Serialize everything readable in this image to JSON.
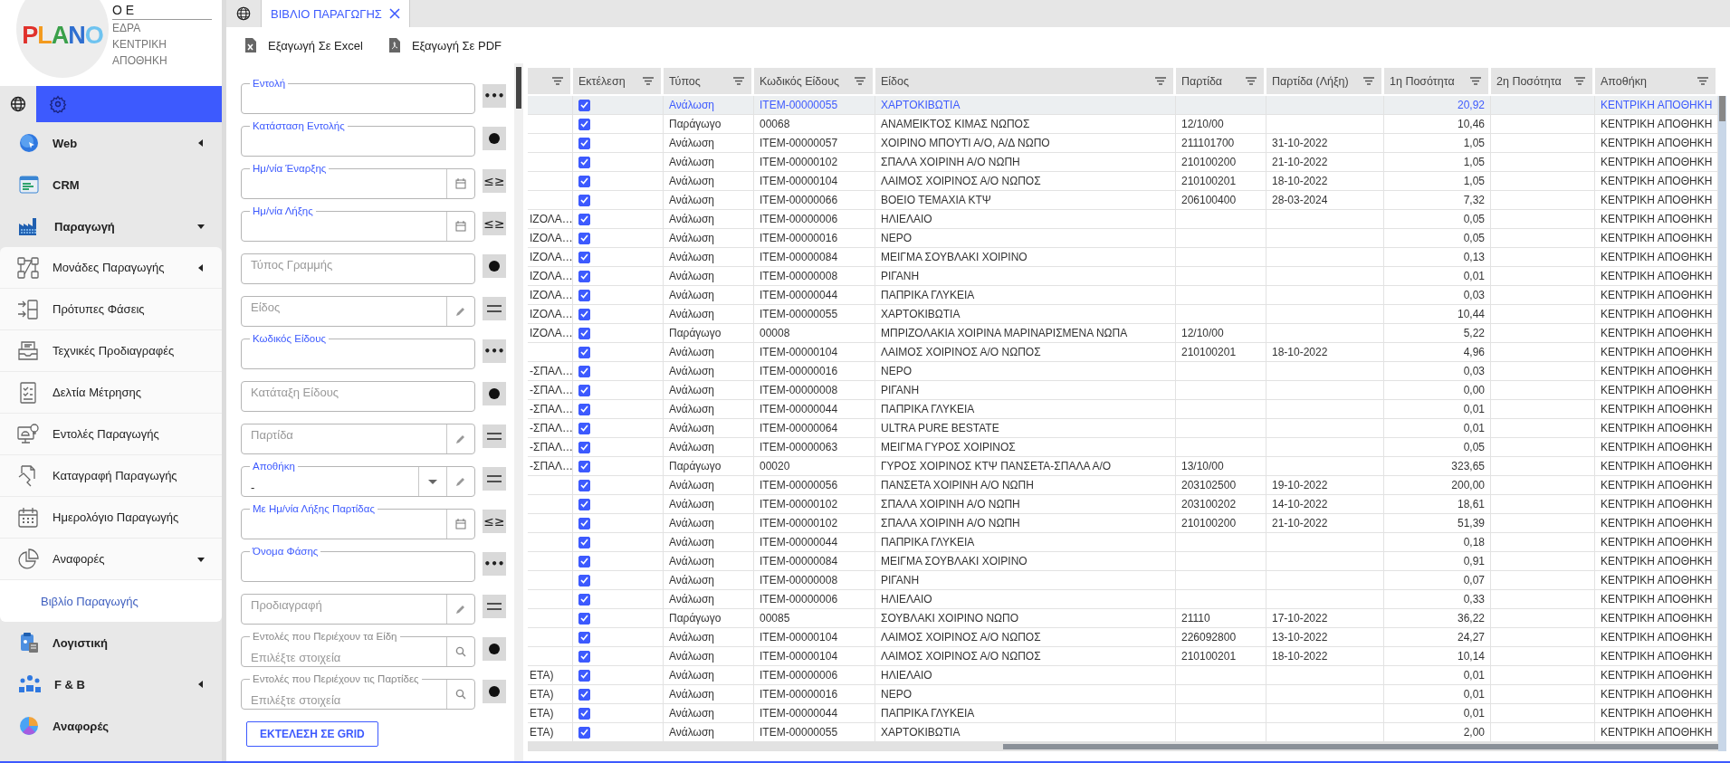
{
  "sidebar": {
    "logo": "PLANO",
    "company": "Ο Ε",
    "branch": "ΕΔΡΑ",
    "warehouse": "ΚΕΝΤΡΙΚΗ ΑΠΟΘΗΚΗ",
    "tabs": [
      {
        "selected": false
      },
      {
        "selected": true
      }
    ],
    "menu": [
      {
        "label": "Web",
        "expanded": false,
        "selected": false
      },
      {
        "label": "CRM",
        "selected": false
      },
      {
        "label": "Παραγωγή",
        "expanded": true,
        "selected": false,
        "children": [
          {
            "label": "Μονάδες Παραγωγής",
            "expanded": false,
            "selected": false
          },
          {
            "label": "Πρότυπες Φάσεις",
            "selected": false
          },
          {
            "label": "Τεχνικές Προδιαγραφές",
            "selected": false
          },
          {
            "label": "Δελτία Μέτρησης",
            "selected": false
          },
          {
            "label": "Εντολές Παραγωγής",
            "selected": false
          },
          {
            "label": "Καταγραφή Παραγωγής",
            "selected": false
          },
          {
            "label": "Ημερολόγιο Παραγωγής",
            "selected": false
          },
          {
            "label": "Αναφορές",
            "expanded": true,
            "selected": false,
            "children": [
              {
                "label": "Βιβλίο Παραγωγής",
                "selected": true
              }
            ]
          }
        ]
      },
      {
        "label": "Λογιστική",
        "selected": false
      },
      {
        "label": "F & B",
        "expanded": false,
        "selected": false
      },
      {
        "label": "Αναφορές",
        "selected": false
      }
    ]
  },
  "tabs": [
    {
      "kind": "home",
      "selected": false
    },
    {
      "kind": "document",
      "label": "ΒΙΒΛΙΟ ΠΑΡΑΓΩΓΗΣ",
      "selected": true,
      "closable": true
    }
  ],
  "toolbar": {
    "actions": [
      {
        "kind": "excel",
        "label": "Εξαγωγή Σε Excel"
      },
      {
        "kind": "pdf",
        "label": "Εξαγωγή Σε PDF"
      }
    ]
  },
  "filters": {
    "fields": [
      {
        "label": "Εντολή",
        "label_highlighted": true,
        "button": {
          "kind": "more",
          "text": "•••"
        }
      },
      {
        "label": "Κατάσταση Εντολής",
        "label_highlighted": true,
        "button": {
          "kind": "dot"
        }
      },
      {
        "label": "Ημ/νία Έναρξης",
        "label_highlighted": true,
        "adornments": [
          {
            "kind": "calendar"
          }
        ],
        "button": {
          "kind": "range",
          "text": "≤≥"
        }
      },
      {
        "label": "Ημ/νία Λήξης",
        "label_highlighted": true,
        "adornments": [
          {
            "kind": "calendar"
          }
        ],
        "button": {
          "kind": "range",
          "text": "≤≥"
        }
      },
      {
        "placeholder": "Τύπος Γραμμής",
        "button": {
          "kind": "dot"
        }
      },
      {
        "placeholder": "Είδος",
        "adornments": [
          {
            "kind": "pencil"
          }
        ],
        "button": {
          "kind": "equals"
        }
      },
      {
        "label": "Κωδικός Είδους",
        "label_highlighted": true,
        "button": {
          "kind": "more",
          "text": "•••"
        }
      },
      {
        "placeholder": "Κατάταξη Είδους",
        "button": {
          "kind": "dot"
        }
      },
      {
        "placeholder": "Παρτίδα",
        "adornments": [
          {
            "kind": "pencil"
          }
        ],
        "button": {
          "kind": "equals"
        }
      },
      {
        "label": "Αποθήκη",
        "label_highlighted": true,
        "value": "-",
        "adornments": [
          {
            "kind": "dropdown"
          },
          {
            "kind": "pencil"
          }
        ],
        "button": {
          "kind": "equals"
        }
      },
      {
        "label": "Με Ημ/νία Λήξης Παρτίδας",
        "label_highlighted": true,
        "adornments": [
          {
            "kind": "calendar"
          }
        ],
        "button": {
          "kind": "range",
          "text": "≤≥"
        }
      },
      {
        "label": "Όνομα Φάσης",
        "label_highlighted": true,
        "button": {
          "kind": "more",
          "text": "•••"
        }
      },
      {
        "placeholder": "Προδιαγραφή",
        "adornments": [
          {
            "kind": "pencil"
          }
        ],
        "button": {
          "kind": "equals"
        }
      },
      {
        "label": "Εντολές που Περιέχουν τα Είδη",
        "label_highlighted": false,
        "placeholder": "Επιλέξτε στοιχεία",
        "adornments": [
          {
            "kind": "search"
          }
        ],
        "button": {
          "kind": "dot"
        }
      },
      {
        "label": "Εντολές που Περιέχουν τις Παρτίδες",
        "label_highlighted": false,
        "placeholder": "Επιλέξτε στοιχεία",
        "adornments": [
          {
            "kind": "search"
          }
        ],
        "button": {
          "kind": "dot"
        }
      }
    ],
    "run_button": "ΕΚΤΕΛΕΣΗ ΣΕ GRID"
  },
  "table": {
    "columns": [
      {
        "kind": "text"
      },
      {
        "kind": "check",
        "label": "Εκτέλεση"
      },
      {
        "kind": "text",
        "label": "Τύπος"
      },
      {
        "kind": "text",
        "label": "Κωδικός Είδους"
      },
      {
        "kind": "text",
        "label": "Είδος"
      },
      {
        "kind": "text",
        "label": "Παρτίδα"
      },
      {
        "kind": "text",
        "label": "Παρτίδα (Λήξη)"
      },
      {
        "kind": "number",
        "label": "1η Ποσότητα"
      },
      {
        "kind": "number",
        "label": "2η Ποσότητα"
      },
      {
        "kind": "text",
        "label": "Αποθήκη"
      }
    ],
    "rows": [
      {
        "selected": true,
        "executed": true,
        "type": "Ανάλωση",
        "item_code": "ITEM-00000055",
        "item": "ΧΑΡΤΟΚΙΒΩΤΙΑ",
        "quantity_1": "20,92",
        "warehouse": "ΚΕΝΤΡΙΚΗ ΑΠΟΘΗΚΗ"
      },
      {
        "selected": false,
        "executed": true,
        "type": "Παράγωγο",
        "item_code": "00068",
        "item": "ΑΝΑΜΕΙΚΤΟΣ ΚΙΜΑΣ ΝΩΠΟΣ",
        "batch": "12/10/00",
        "quantity_1": "10,46",
        "warehouse": "ΚΕΝΤΡΙΚΗ ΑΠΟΘΗΚΗ"
      },
      {
        "selected": false,
        "executed": true,
        "type": "Ανάλωση",
        "item_code": "ITEM-00000057",
        "item": "ΧΟΙΡΙΝΟ ΜΠΟΥΤΙ Α/Ο, Α/Δ ΝΩΠΟ",
        "batch": "211101700",
        "batch_expiry": "31-10-2022",
        "quantity_1": "1,05",
        "warehouse": "ΚΕΝΤΡΙΚΗ ΑΠΟΘΗΚΗ"
      },
      {
        "selected": false,
        "executed": true,
        "type": "Ανάλωση",
        "item_code": "ITEM-00000102",
        "item": "ΣΠΑΛΑ ΧΟΙΡΙΝΗ Α/Ο ΝΩΠΗ",
        "batch": "210100200",
        "batch_expiry": "21-10-2022",
        "quantity_1": "1,05",
        "warehouse": "ΚΕΝΤΡΙΚΗ ΑΠΟΘΗΚΗ"
      },
      {
        "selected": false,
        "executed": true,
        "type": "Ανάλωση",
        "item_code": "ITEM-00000104",
        "item": "ΛΑΙΜΟΣ ΧΟΙΡΙΝΟΣ Α/Ο ΝΩΠΟΣ",
        "batch": "210100201",
        "batch_expiry": "18-10-2022",
        "quantity_1": "1,05",
        "warehouse": "ΚΕΝΤΡΙΚΗ ΑΠΟΘΗΚΗ"
      },
      {
        "selected": false,
        "executed": true,
        "type": "Ανάλωση",
        "item_code": "ITEM-00000066",
        "item": "ΒΟΕΙΟ ΤΕΜΑΧΙΑ ΚΤΨ",
        "batch": "206100400",
        "batch_expiry": "28-03-2024",
        "quantity_1": "7,32",
        "warehouse": "ΚΕΝΤΡΙΚΗ ΑΠΟΘΗΚΗ"
      },
      {
        "selected": false,
        "column_1": "ΙΖΟΛΑ…",
        "executed": true,
        "type": "Ανάλωση",
        "item_code": "ITEM-00000006",
        "item": "ΗΛΙΕΛΑΙΟ",
        "quantity_1": "0,05",
        "warehouse": "ΚΕΝΤΡΙΚΗ ΑΠΟΘΗΚΗ"
      },
      {
        "selected": false,
        "column_1": "ΙΖΟΛΑ…",
        "executed": true,
        "type": "Ανάλωση",
        "item_code": "ITEM-00000016",
        "item": "ΝΕΡΟ",
        "quantity_1": "0,05",
        "warehouse": "ΚΕΝΤΡΙΚΗ ΑΠΟΘΗΚΗ"
      },
      {
        "selected": false,
        "column_1": "ΙΖΟΛΑ…",
        "executed": true,
        "type": "Ανάλωση",
        "item_code": "ITEM-00000084",
        "item": "ΜΕΙΓΜΑ ΣΟΥΒΛΑΚΙ ΧΟΙΡΙΝΟ",
        "quantity_1": "0,13",
        "warehouse": "ΚΕΝΤΡΙΚΗ ΑΠΟΘΗΚΗ"
      },
      {
        "selected": false,
        "column_1": "ΙΖΟΛΑ…",
        "executed": true,
        "type": "Ανάλωση",
        "item_code": "ITEM-00000008",
        "item": "ΡΙΓΑΝΗ",
        "quantity_1": "0,01",
        "warehouse": "ΚΕΝΤΡΙΚΗ ΑΠΟΘΗΚΗ"
      },
      {
        "selected": false,
        "column_1": "ΙΖΟΛΑ…",
        "executed": true,
        "type": "Ανάλωση",
        "item_code": "ITEM-00000044",
        "item": "ΠΑΠΡΙΚΑ ΓΛΥΚΕΙΑ",
        "quantity_1": "0,03",
        "warehouse": "ΚΕΝΤΡΙΚΗ ΑΠΟΘΗΚΗ"
      },
      {
        "selected": false,
        "column_1": "ΙΖΟΛΑ…",
        "executed": true,
        "type": "Ανάλωση",
        "item_code": "ITEM-00000055",
        "item": "ΧΑΡΤΟΚΙΒΩΤΙΑ",
        "quantity_1": "10,44",
        "warehouse": "ΚΕΝΤΡΙΚΗ ΑΠΟΘΗΚΗ"
      },
      {
        "selected": false,
        "column_1": "ΙΖΟΛΑ…",
        "executed": true,
        "type": "Παράγωγο",
        "item_code": "00008",
        "item": "ΜΠΡΙΖΟΛΑΚΙΑ ΧΟΙΡΙΝΑ ΜΑΡΙΝΑΡΙΣΜΕΝΑ ΝΩΠΑ",
        "batch": "12/10/00",
        "quantity_1": "5,22",
        "warehouse": "ΚΕΝΤΡΙΚΗ ΑΠΟΘΗΚΗ"
      },
      {
        "selected": false,
        "executed": true,
        "type": "Ανάλωση",
        "item_code": "ITEM-00000104",
        "item": "ΛΑΙΜΟΣ ΧΟΙΡΙΝΟΣ Α/Ο ΝΩΠΟΣ",
        "batch": "210100201",
        "batch_expiry": "18-10-2022",
        "quantity_1": "4,96",
        "warehouse": "ΚΕΝΤΡΙΚΗ ΑΠΟΘΗΚΗ"
      },
      {
        "selected": false,
        "column_1": "-ΣΠΑΛ…",
        "executed": true,
        "type": "Ανάλωση",
        "item_code": "ITEM-00000016",
        "item": "ΝΕΡΟ",
        "quantity_1": "0,03",
        "warehouse": "ΚΕΝΤΡΙΚΗ ΑΠΟΘΗΚΗ"
      },
      {
        "selected": false,
        "column_1": "-ΣΠΑΛ…",
        "executed": true,
        "type": "Ανάλωση",
        "item_code": "ITEM-00000008",
        "item": "ΡΙΓΑΝΗ",
        "quantity_1": "0,00",
        "warehouse": "ΚΕΝΤΡΙΚΗ ΑΠΟΘΗΚΗ"
      },
      {
        "selected": false,
        "column_1": "-ΣΠΑΛ…",
        "executed": true,
        "type": "Ανάλωση",
        "item_code": "ITEM-00000044",
        "item": "ΠΑΠΡΙΚΑ ΓΛΥΚΕΙΑ",
        "quantity_1": "0,01",
        "warehouse": "ΚΕΝΤΡΙΚΗ ΑΠΟΘΗΚΗ"
      },
      {
        "selected": false,
        "column_1": "-ΣΠΑΛ…",
        "executed": true,
        "type": "Ανάλωση",
        "item_code": "ITEM-00000064",
        "item": "ULTRA PURE BESTATE",
        "quantity_1": "0,01",
        "warehouse": "ΚΕΝΤΡΙΚΗ ΑΠΟΘΗΚΗ"
      },
      {
        "selected": false,
        "column_1": "-ΣΠΑΛ…",
        "executed": true,
        "type": "Ανάλωση",
        "item_code": "ITEM-00000063",
        "item": "ΜΕΙΓΜΑ ΓΥΡΟΣ ΧΟΙΡΙΝΟΣ",
        "quantity_1": "0,05",
        "warehouse": "ΚΕΝΤΡΙΚΗ ΑΠΟΘΗΚΗ"
      },
      {
        "selected": false,
        "column_1": "-ΣΠΑΛ…",
        "executed": true,
        "type": "Παράγωγο",
        "item_code": "00020",
        "item": "ΓΥΡΟΣ ΧΟΙΡΙΝΟΣ ΚΤΨ ΠΑΝΣΕΤΑ-ΣΠΑΛΑ Α/Ο",
        "batch": "13/10/00",
        "quantity_1": "323,65",
        "warehouse": "ΚΕΝΤΡΙΚΗ ΑΠΟΘΗΚΗ"
      },
      {
        "selected": false,
        "executed": true,
        "type": "Ανάλωση",
        "item_code": "ITEM-00000056",
        "item": "ΠΑΝΣΕΤΑ ΧΟΙΡΙΝΗ Α/Ο ΝΩΠΗ",
        "batch": "203102500",
        "batch_expiry": "19-10-2022",
        "quantity_1": "200,00",
        "warehouse": "ΚΕΝΤΡΙΚΗ ΑΠΟΘΗΚΗ"
      },
      {
        "selected": false,
        "executed": true,
        "type": "Ανάλωση",
        "item_code": "ITEM-00000102",
        "item": "ΣΠΑΛΑ ΧΟΙΡΙΝΗ Α/Ο ΝΩΠΗ",
        "batch": "203100202",
        "batch_expiry": "14-10-2022",
        "quantity_1": "18,61",
        "warehouse": "ΚΕΝΤΡΙΚΗ ΑΠΟΘΗΚΗ"
      },
      {
        "selected": false,
        "executed": true,
        "type": "Ανάλωση",
        "item_code": "ITEM-00000102",
        "item": "ΣΠΑΛΑ ΧΟΙΡΙΝΗ Α/Ο ΝΩΠΗ",
        "batch": "210100200",
        "batch_expiry": "21-10-2022",
        "quantity_1": "51,39",
        "warehouse": "ΚΕΝΤΡΙΚΗ ΑΠΟΘΗΚΗ"
      },
      {
        "selected": false,
        "executed": true,
        "type": "Ανάλωση",
        "item_code": "ITEM-00000044",
        "item": "ΠΑΠΡΙΚΑ ΓΛΥΚΕΙΑ",
        "quantity_1": "0,18",
        "warehouse": "ΚΕΝΤΡΙΚΗ ΑΠΟΘΗΚΗ"
      },
      {
        "selected": false,
        "executed": true,
        "type": "Ανάλωση",
        "item_code": "ITEM-00000084",
        "item": "ΜΕΙΓΜΑ ΣΟΥΒΛΑΚΙ ΧΟΙΡΙΝΟ",
        "quantity_1": "0,91",
        "warehouse": "ΚΕΝΤΡΙΚΗ ΑΠΟΘΗΚΗ"
      },
      {
        "selected": false,
        "executed": true,
        "type": "Ανάλωση",
        "item_code": "ITEM-00000008",
        "item": "ΡΙΓΑΝΗ",
        "quantity_1": "0,07",
        "warehouse": "ΚΕΝΤΡΙΚΗ ΑΠΟΘΗΚΗ"
      },
      {
        "selected": false,
        "executed": true,
        "type": "Ανάλωση",
        "item_code": "ITEM-00000006",
        "item": "ΗΛΙΕΛΑΙΟ",
        "quantity_1": "0,33",
        "warehouse": "ΚΕΝΤΡΙΚΗ ΑΠΟΘΗΚΗ"
      },
      {
        "selected": false,
        "executed": true,
        "type": "Παράγωγο",
        "item_code": "00085",
        "item": "ΣΟΥΒΛΑΚΙ ΧΟΙΡΙΝΟ ΝΩΠΟ",
        "batch": "21110",
        "batch_expiry": "17-10-2022",
        "quantity_1": "36,22",
        "warehouse": "ΚΕΝΤΡΙΚΗ ΑΠΟΘΗΚΗ"
      },
      {
        "selected": false,
        "executed": true,
        "type": "Ανάλωση",
        "item_code": "ITEM-00000104",
        "item": "ΛΑΙΜΟΣ ΧΟΙΡΙΝΟΣ Α/Ο ΝΩΠΟΣ",
        "batch": "226092800",
        "batch_expiry": "13-10-2022",
        "quantity_1": "24,27",
        "warehouse": "ΚΕΝΤΡΙΚΗ ΑΠΟΘΗΚΗ"
      },
      {
        "selected": false,
        "executed": true,
        "type": "Ανάλωση",
        "item_code": "ITEM-00000104",
        "item": "ΛΑΙΜΟΣ ΧΟΙΡΙΝΟΣ Α/Ο ΝΩΠΟΣ",
        "batch": "210100201",
        "batch_expiry": "18-10-2022",
        "quantity_1": "10,14",
        "warehouse": "ΚΕΝΤΡΙΚΗ ΑΠΟΘΗΚΗ"
      },
      {
        "selected": false,
        "column_1": "ΕΤΑ)",
        "executed": true,
        "type": "Ανάλωση",
        "item_code": "ITEM-00000006",
        "item": "ΗΛΙΕΛΑΙΟ",
        "quantity_1": "0,01",
        "warehouse": "ΚΕΝΤΡΙΚΗ ΑΠΟΘΗΚΗ"
      },
      {
        "selected": false,
        "column_1": "ΕΤΑ)",
        "executed": true,
        "type": "Ανάλωση",
        "item_code": "ITEM-00000016",
        "item": "ΝΕΡΟ",
        "quantity_1": "0,01",
        "warehouse": "ΚΕΝΤΡΙΚΗ ΑΠΟΘΗΚΗ"
      },
      {
        "selected": false,
        "column_1": "ΕΤΑ)",
        "executed": true,
        "type": "Ανάλωση",
        "item_code": "ITEM-00000044",
        "item": "ΠΑΠΡΙΚΑ ΓΛΥΚΕΙΑ",
        "quantity_1": "0,01",
        "warehouse": "ΚΕΝΤΡΙΚΗ ΑΠΟΘΗΚΗ"
      },
      {
        "selected": false,
        "column_1": "ΕΤΑ)",
        "executed": true,
        "type": "Ανάλωση",
        "item_code": "ITEM-00000055",
        "item": "ΧΑΡΤΟΚΙΒΩΤΙΑ",
        "quantity_1": "2,00",
        "warehouse": "ΚΕΝΤΡΙΚΗ ΑΠΟΘΗΚΗ"
      }
    ]
  }
}
